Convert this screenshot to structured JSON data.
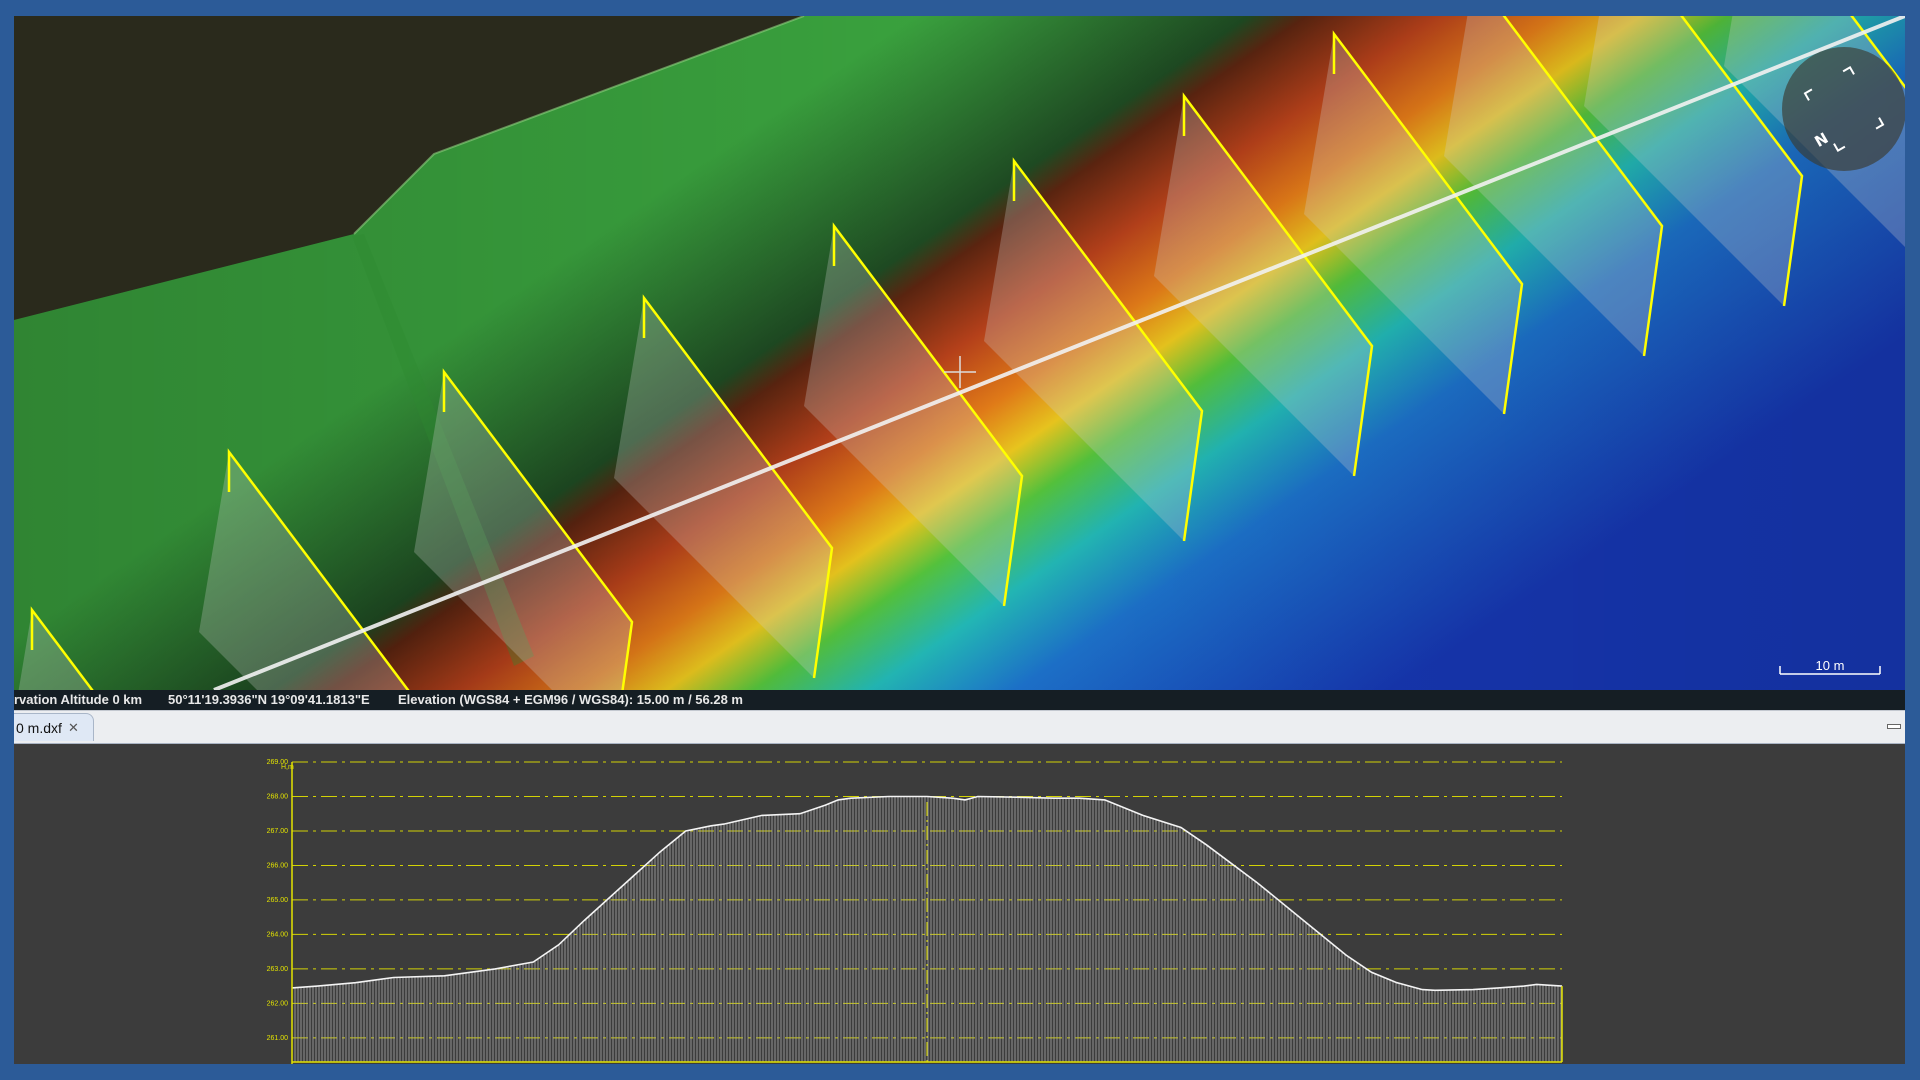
{
  "status_bar": {
    "observation_altitude": "rvation Altitude 0 km",
    "coordinates": "50°11'19.3936\"N 19°09'41.1813\"E",
    "elevation": "Elevation (WGS84 + EGM96 / WGS84): 15.00 m / 56.28 m"
  },
  "scale_bar": {
    "label": "10 m"
  },
  "compass": {
    "label": "N",
    "icon": "compass-icon"
  },
  "tab": {
    "title": "0 m.dxf",
    "close_icon": "close-icon"
  },
  "colors": {
    "profile_line": "#ffff00",
    "terrain_high": "#a83a10",
    "terrain_mid": "#2fa83a",
    "terrain_low": "#1a3fb0",
    "panel_background": "#3c3c3c"
  },
  "chart_data": {
    "type": "area",
    "ylabel": "H,m",
    "y_ticks": [
      "261.00",
      "262.00",
      "263.00",
      "264.00",
      "265.00",
      "266.00",
      "267.00",
      "268.00",
      "269.00"
    ],
    "ylim": [
      260.3,
      269.0
    ],
    "xlim": [
      0,
      100
    ],
    "grid": true,
    "x": [
      0,
      2,
      5,
      8,
      12,
      16,
      19,
      21,
      23,
      26,
      29,
      31,
      33,
      34,
      37,
      40,
      42,
      43,
      44,
      47,
      50,
      52,
      53,
      54,
      57,
      60,
      62,
      64,
      67,
      70,
      72,
      76,
      80,
      83,
      85,
      87,
      89,
      90,
      93,
      95,
      97,
      98,
      100
    ],
    "values": [
      262.45,
      262.5,
      262.6,
      262.75,
      262.8,
      263.0,
      263.2,
      263.7,
      264.4,
      265.4,
      266.4,
      267.0,
      267.15,
      267.2,
      267.45,
      267.5,
      267.75,
      267.9,
      267.95,
      268.0,
      268.0,
      267.95,
      267.9,
      268.0,
      267.98,
      267.95,
      267.95,
      267.9,
      267.45,
      267.1,
      266.6,
      265.5,
      264.3,
      263.4,
      262.9,
      262.6,
      262.4,
      262.38,
      262.4,
      262.45,
      262.5,
      262.55,
      262.5
    ]
  }
}
